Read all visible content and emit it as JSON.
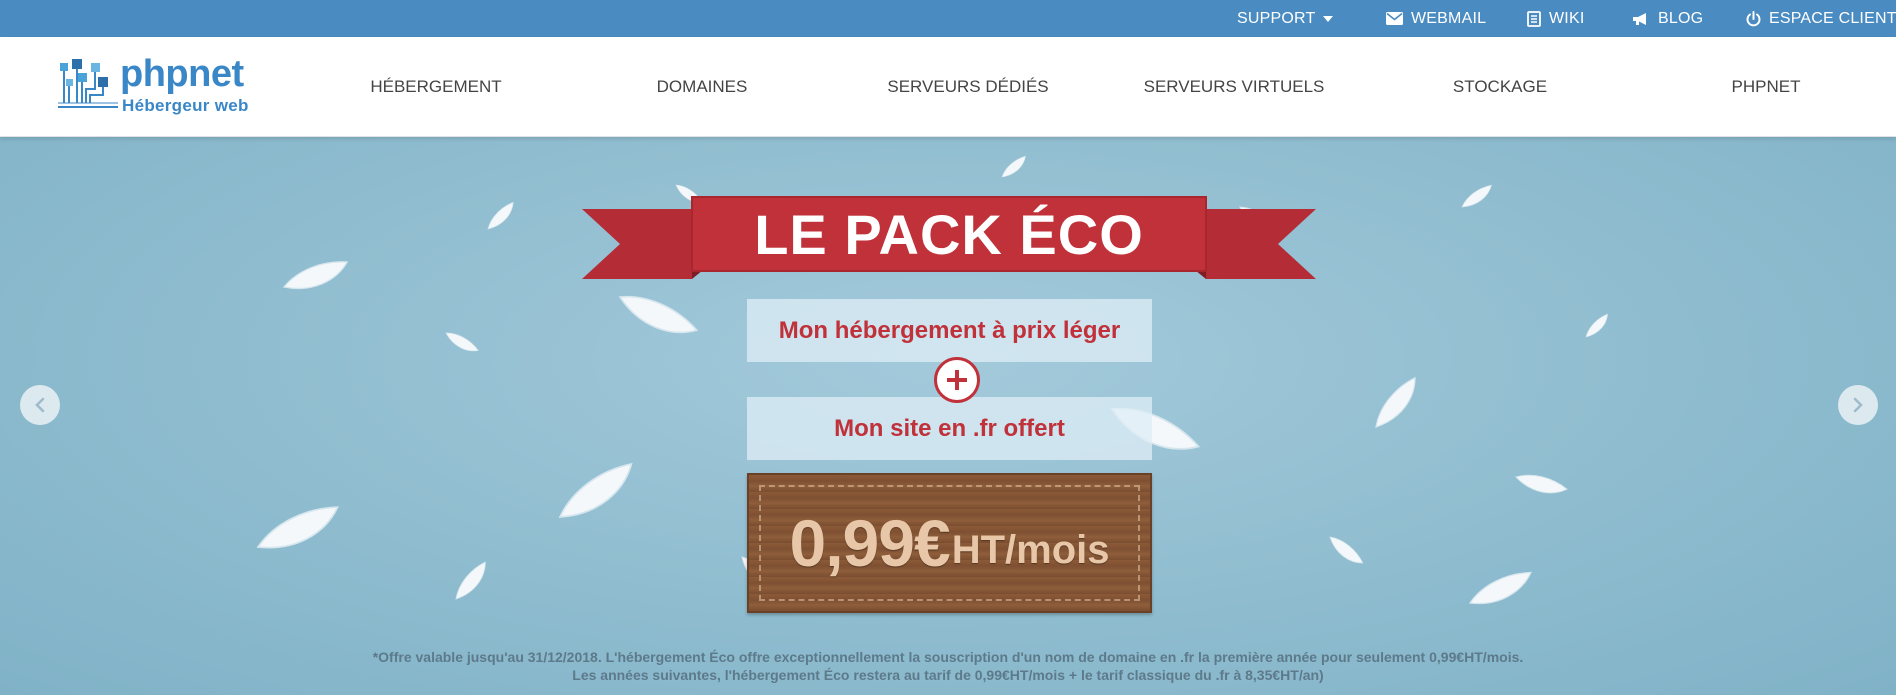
{
  "topbar": {
    "support": "SUPPORT",
    "webmail": "WEBMAIL",
    "wiki": "WIKI",
    "blog": "BLOG",
    "espace_client": "ESPACE CLIENT"
  },
  "logo": {
    "name": "phpnet",
    "tagline": "Hébergeur web"
  },
  "nav": [
    "HÉBERGEMENT",
    "DOMAINES",
    "SERVEURS DÉDIÉS",
    "SERVEURS VIRTUELS",
    "STOCKAGE",
    "PHPNET"
  ],
  "hero": {
    "title": "LE PACK ÉCO",
    "line1": "Mon hébergement à prix léger",
    "line2": "Mon site en .fr offert",
    "price": "0,99€",
    "price_unit": "HT/mois",
    "disclaimer_1": "*Offre valable jusqu'au 31/12/2018. L'hébergement Éco offre exceptionnellement la souscription d'un nom de domaine en .fr  la première année pour seulement 0,99€HT/mois.",
    "disclaimer_2": "Les années suivantes, l'hébergement Éco restera au tarif de 0,99€HT/mois + le tarif classique du .fr à 8,35€HT/an)"
  },
  "icons": {
    "support": "chevron-down-icon",
    "webmail": "envelope-icon",
    "wiki": "book-icon",
    "blog": "megaphone-icon",
    "espace_client": "power-icon",
    "carousel_prev": "chevron-left-icon",
    "carousel_next": "chevron-right-icon",
    "plus": "plus-icon"
  },
  "colors": {
    "topbar": "#4a8bc2",
    "brand": "#3a87c8",
    "ribbon": "#c0313a",
    "sky": "#8fbccf",
    "wood": "#8b5a38"
  }
}
